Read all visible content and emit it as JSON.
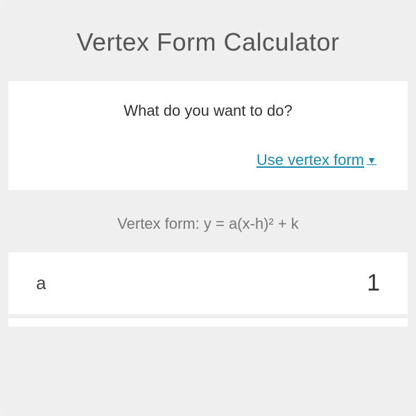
{
  "header": {
    "title": "Vertex Form Calculator"
  },
  "question": {
    "prompt": "What do you want to do?",
    "dropdown_label": "Use vertex form"
  },
  "formula": {
    "label": "Vertex form: y = a(x-h)² + k"
  },
  "inputs": {
    "a": {
      "label": "a",
      "value": "1"
    }
  }
}
